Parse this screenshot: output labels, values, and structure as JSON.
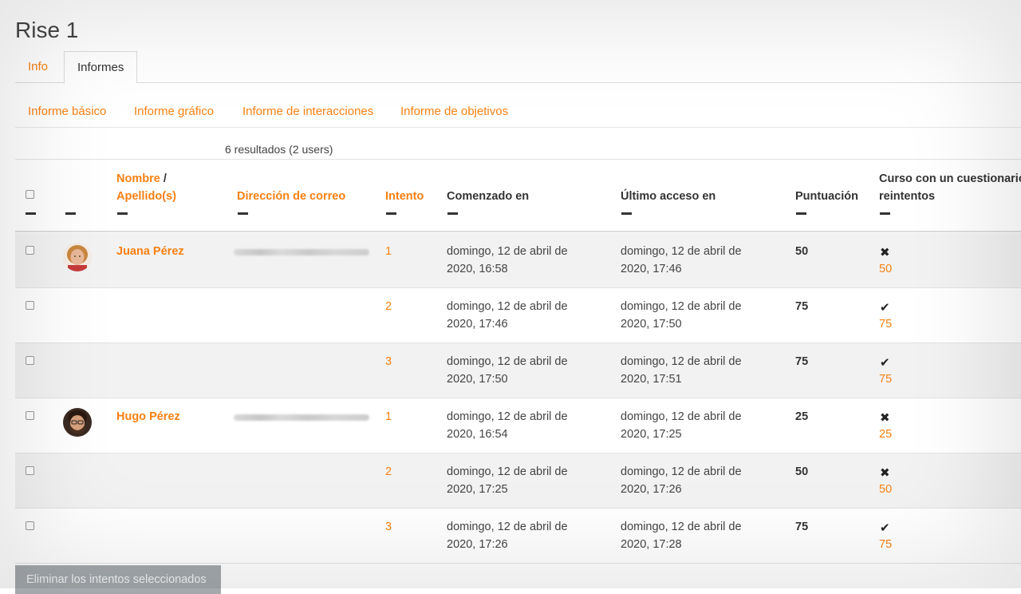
{
  "page": {
    "title": "Rise 1"
  },
  "tabs": [
    {
      "label": "Info"
    },
    {
      "label": "Informes"
    }
  ],
  "subnav": [
    {
      "label": "Informe básico"
    },
    {
      "label": "Informe gráfico"
    },
    {
      "label": "Informe de interacciones"
    },
    {
      "label": "Informe de objetivos"
    }
  ],
  "results_summary": "6 resultados (2 users)",
  "columns": {
    "name": "Nombre",
    "name_sep": "/",
    "surname": "Apellido(s)",
    "email": "Dirección de correo",
    "attempt": "Intento",
    "started": "Comenzado en",
    "last_access": "Último acceso en",
    "score": "Puntuación",
    "course_line1": "Curso con un cuestionario",
    "course_line2": "reintentos"
  },
  "rows": [
    {
      "name": "Juana Pérez",
      "attempt": "1",
      "started_l1": "domingo, 12 de abril de",
      "started_l2": "2020, 16:58",
      "last_l1": "domingo, 12 de abril de",
      "last_l2": "2020, 17:46",
      "score": "50",
      "status": "✖",
      "grade": "50"
    },
    {
      "name": "",
      "attempt": "2",
      "started_l1": "domingo, 12 de abril de",
      "started_l2": "2020, 17:46",
      "last_l1": "domingo, 12 de abril de",
      "last_l2": "2020, 17:50",
      "score": "75",
      "status": "✔",
      "grade": "75"
    },
    {
      "name": "",
      "attempt": "3",
      "started_l1": "domingo, 12 de abril de",
      "started_l2": "2020, 17:50",
      "last_l1": "domingo, 12 de abril de",
      "last_l2": "2020, 17:51",
      "score": "75",
      "status": "✔",
      "grade": "75"
    },
    {
      "name": "Hugo Pérez",
      "attempt": "1",
      "started_l1": "domingo, 12 de abril de",
      "started_l2": "2020, 16:54",
      "last_l1": "domingo, 12 de abril de",
      "last_l2": "2020, 17:25",
      "score": "25",
      "status": "✖",
      "grade": "25"
    },
    {
      "name": "",
      "attempt": "2",
      "started_l1": "domingo, 12 de abril de",
      "started_l2": "2020, 17:25",
      "last_l1": "domingo, 12 de abril de",
      "last_l2": "2020, 17:26",
      "score": "50",
      "status": "✖",
      "grade": "50"
    },
    {
      "name": "",
      "attempt": "3",
      "started_l1": "domingo, 12 de abril de",
      "started_l2": "2020, 17:26",
      "last_l1": "domingo, 12 de abril de",
      "last_l2": "2020, 17:28",
      "score": "75",
      "status": "✔",
      "grade": "75"
    }
  ],
  "delete_button": "Eliminar los intentos seleccionados",
  "colors": {
    "accent": "#f98012",
    "row_alt": "#f2f2f2",
    "button_disabled": "#a4a9ad"
  }
}
